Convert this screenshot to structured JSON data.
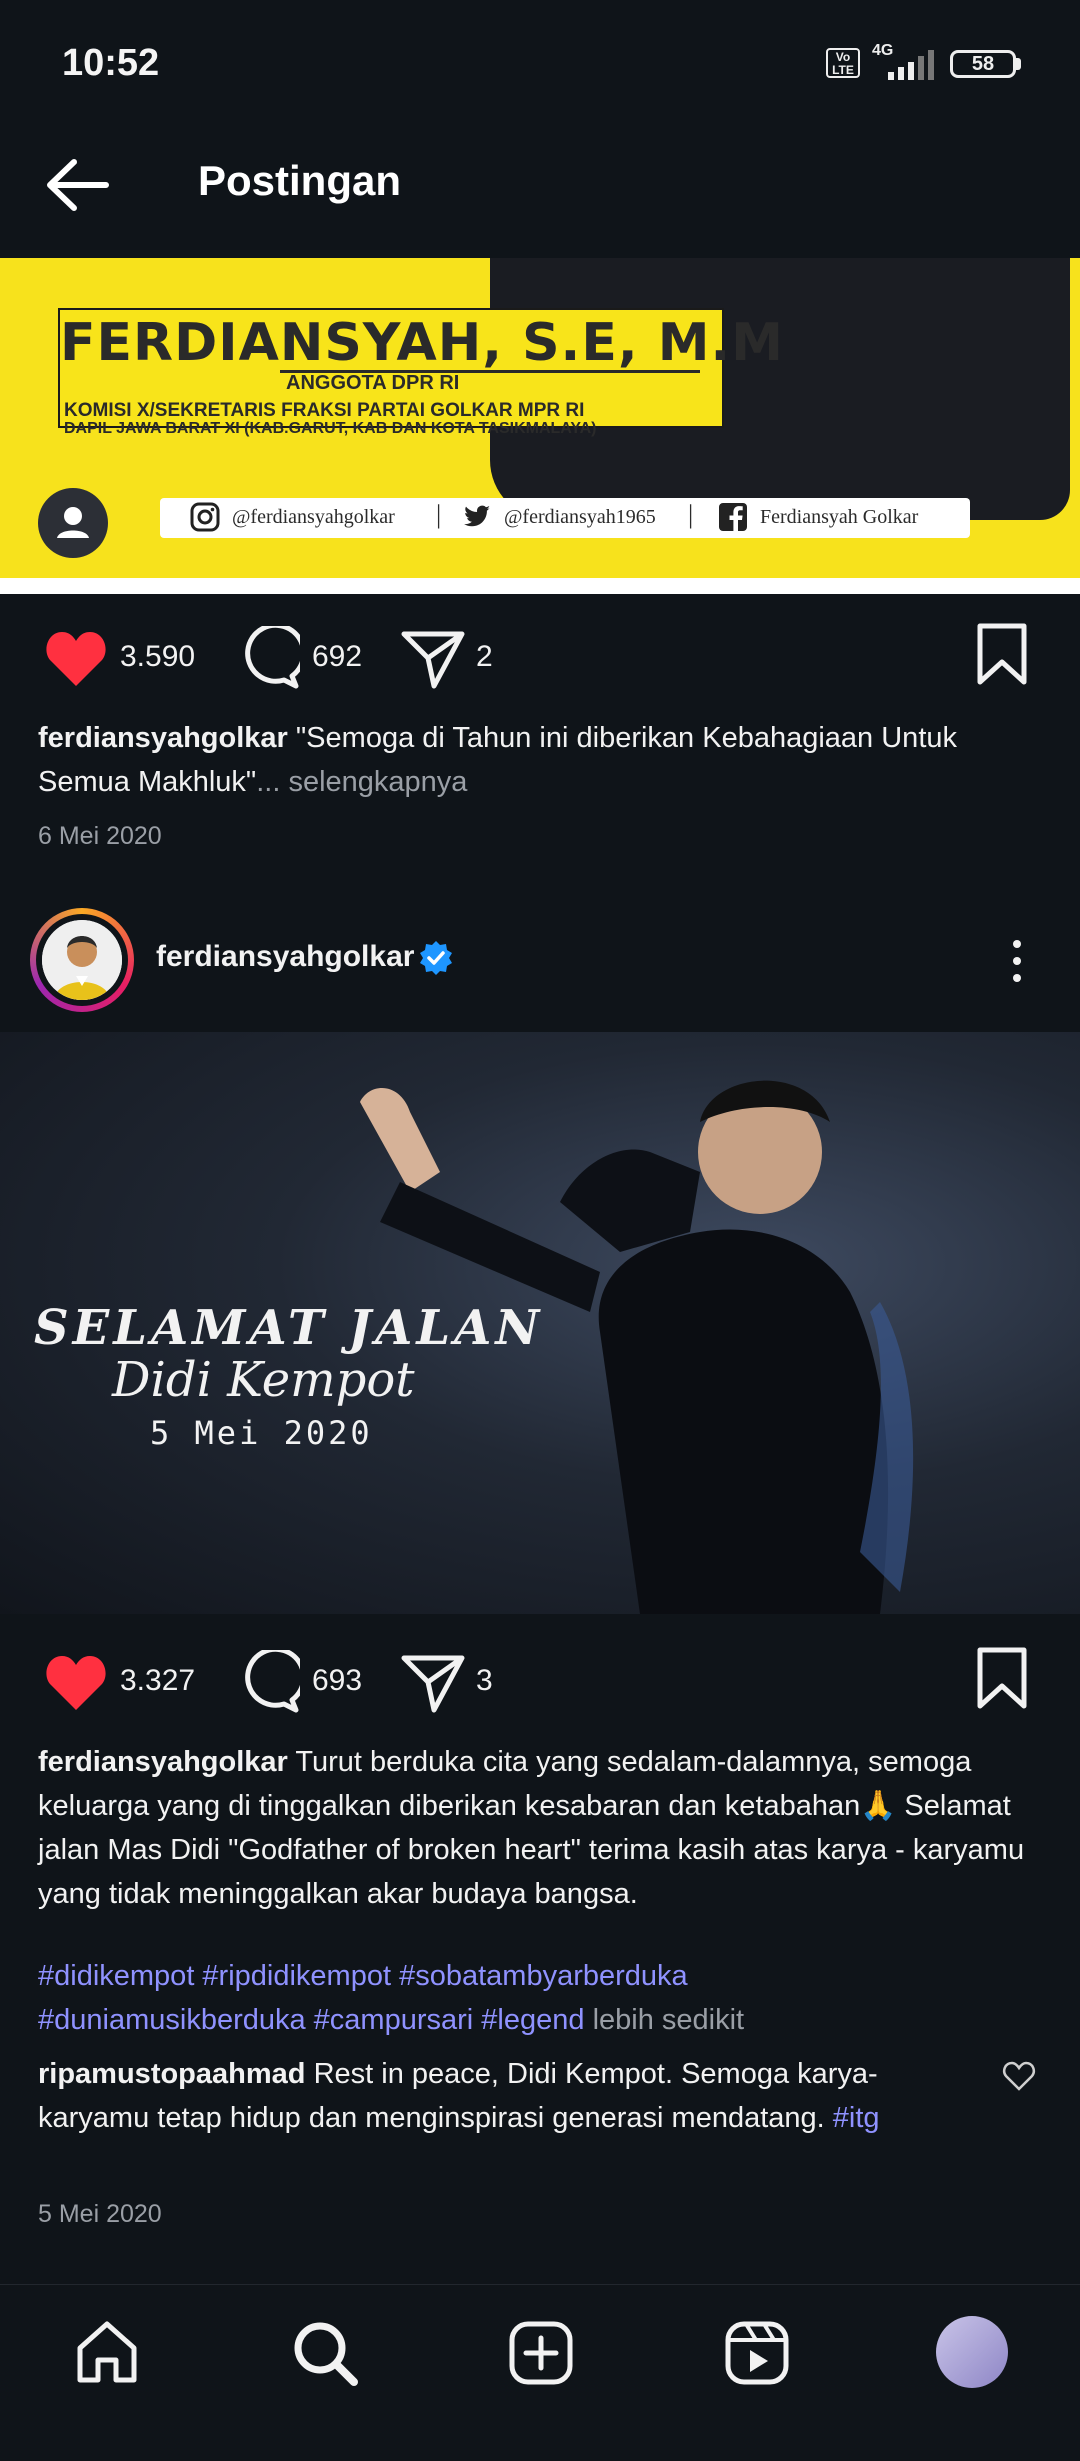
{
  "status_bar": {
    "time": "10:52",
    "volte": "Vo LTE",
    "network": "4G",
    "battery": "58"
  },
  "header": {
    "title": "Postingan"
  },
  "post1": {
    "banner": {
      "name": "FERDIANSYAH, S.E, M.M",
      "role": "ANGGOTA DPR RI",
      "line2": "KOMISI X/SEKRETARIS FRAKSI PARTAI GOLKAR MPR RI",
      "line3": "DAPIL JAWA BARAT XI (KAB.GARUT, KAB DAN KOTA TASIKMALAYA)",
      "instagram": "@ferdiansyahgolkar",
      "twitter": "@ferdiansyah1965",
      "facebook": "Ferdiansyah Golkar"
    },
    "likes": "3.590",
    "comments": "692",
    "shares": "2",
    "caption_user": "ferdiansyahgolkar",
    "caption_text": "\"Semoga di Tahun ini diberikan Kebahagiaan Untuk Semua Makhluk\"",
    "caption_more": "... selengkapnya",
    "date": "6 Mei 2020"
  },
  "post2": {
    "username": "ferdiansyahgolkar",
    "photo_text1": "SELAMAT JALAN",
    "photo_text2": "Didi Kempot",
    "photo_text3": "5 Mei 2020",
    "likes": "3.327",
    "comments": "693",
    "shares": "3",
    "caption_user": "ferdiansyahgolkar",
    "caption_text": "Turut berduka cita yang sedalam-dalamnya, semoga keluarga yang di tinggalkan diberikan kesabaran dan ketabahan🙏 Selamat jalan Mas Didi \"Godfather of broken heart\" terima kasih atas karya - karyamu yang tidak meninggalkan akar budaya bangsa.",
    "hashtags_line1": "#didikempot #ripdidikempot #sobatambyarberduka",
    "hashtags_line2": "#duniamusikberduka #campursari #legend",
    "less": "lebih sedikit",
    "comment_user": "ripamustopaahmad",
    "comment_text": "Rest in peace, Didi Kempot. Semoga karya-karyamu tetap hidup dan menginspirasi generasi mendatang.",
    "comment_tag": "#itg",
    "date": "5 Mei 2020"
  },
  "bottom_nav": [
    "home-icon",
    "search-icon",
    "create-icon",
    "reels-icon",
    "profile-avatar"
  ]
}
